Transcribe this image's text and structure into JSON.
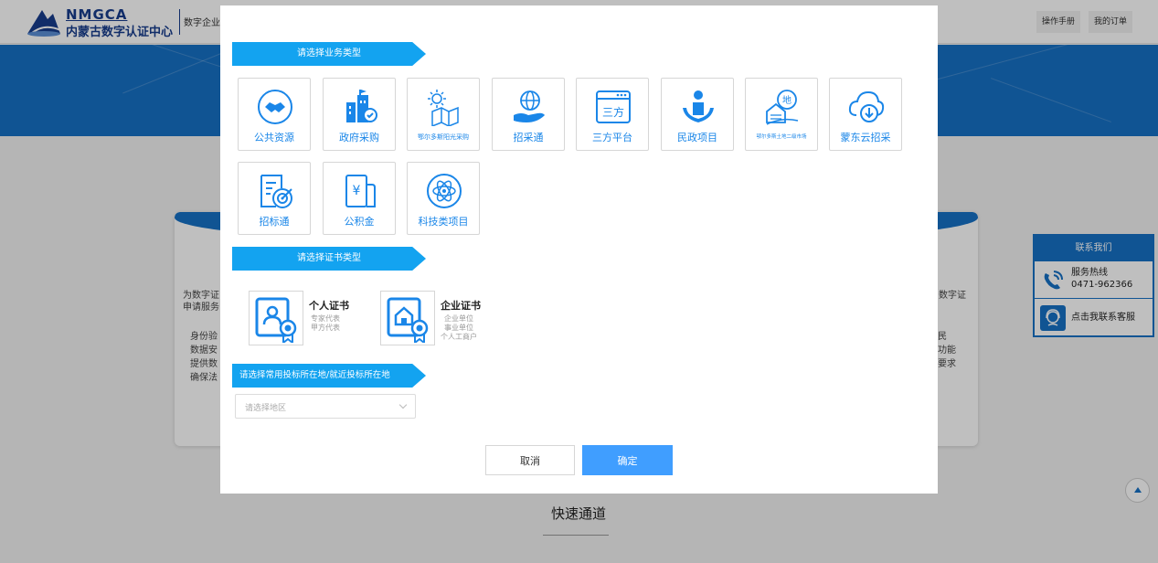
{
  "header": {
    "logo_en": "NMGCA",
    "logo_cn": "内蒙古数字认证中心",
    "subtitle": "数字企业",
    "manual_label": "操作手册",
    "orders_label": "我的订单"
  },
  "background": {
    "left_text_1": "为数字证",
    "left_text_2": "申请服务",
    "left_text_3": "身份验",
    "left_text_4": "数据安",
    "left_text_5": "提供数",
    "left_text_6": "确保法",
    "right_text_1": "数字证",
    "right_text_2": "民",
    "right_text_3": "功能",
    "right_text_4": "要求",
    "quick_title": "快速通道"
  },
  "contact": {
    "title": "联系我们",
    "hotline_label": "服务热线",
    "hotline_number": "0471-962366",
    "service_label": "点击我联系客服"
  },
  "modal": {
    "business_title": "请选择业务类型",
    "business_items": [
      {
        "label": "公共资源",
        "icon": "handshake-icon"
      },
      {
        "label": "政府采购",
        "icon": "government-building-icon"
      },
      {
        "label": "鄂尔多斯阳光采购",
        "icon": "sun-map-icon"
      },
      {
        "label": "招采通",
        "icon": "globe-hand-icon"
      },
      {
        "label": "三方平台",
        "icon": "three-party-icon"
      },
      {
        "label": "民政项目",
        "icon": "people-care-icon"
      },
      {
        "label": "鄂尔多斯土地二级市场",
        "icon": "land-market-icon"
      },
      {
        "label": "蒙东云招采",
        "icon": "cloud-download-icon"
      },
      {
        "label": "招标通",
        "icon": "target-document-icon"
      },
      {
        "label": "公积金",
        "icon": "yuan-card-icon"
      },
      {
        "label": "科技类项目",
        "icon": "atom-icon"
      }
    ],
    "cert_title": "请选择证书类型",
    "personal_cert": {
      "title": "个人证书",
      "desc_1": "专家代表",
      "desc_2": "甲方代表"
    },
    "enterprise_cert": {
      "title": "企业证书",
      "desc_1": "企业单位",
      "desc_2": "事业单位",
      "desc_3": "个人工商户"
    },
    "region_title": "请选择常用投标所在地/就近投标所在地",
    "region_placeholder": "请选择地区",
    "cancel_label": "取消",
    "confirm_label": "确定"
  },
  "colors": {
    "brand_blue": "#1670c4",
    "section_blue": "#13a3f0",
    "icon_blue": "#1a86e8",
    "primary_button": "#409eff"
  }
}
